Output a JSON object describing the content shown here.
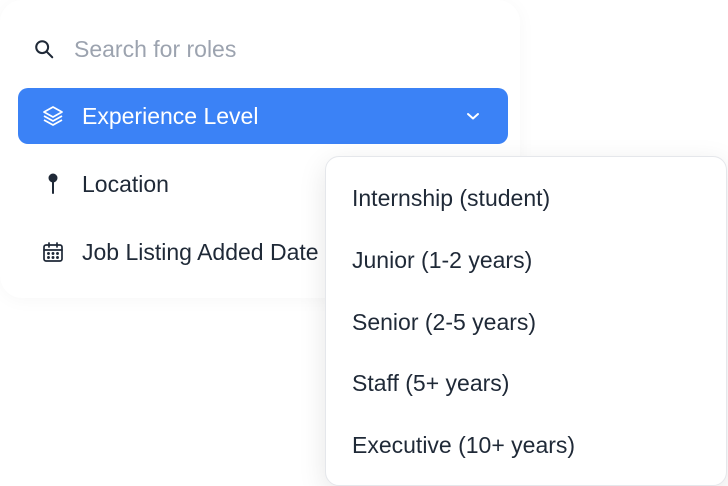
{
  "search": {
    "placeholder": "Search for roles",
    "value": ""
  },
  "filters": [
    {
      "label": "Experience Level",
      "icon": "layers-icon",
      "active": true
    },
    {
      "label": "Location",
      "icon": "pin-icon",
      "active": false
    },
    {
      "label": "Job Listing Added Date",
      "icon": "calendar-icon",
      "active": false
    }
  ],
  "dropdown": {
    "options": [
      "Internship (student)",
      "Junior (1-2 years)",
      "Senior (2-5 years)",
      "Staff (5+ years)",
      "Executive (10+ years)"
    ]
  },
  "colors": {
    "accent": "#3b82f6",
    "text": "#1f2937",
    "placeholder": "#9ca3af",
    "border": "#e5e7eb"
  }
}
